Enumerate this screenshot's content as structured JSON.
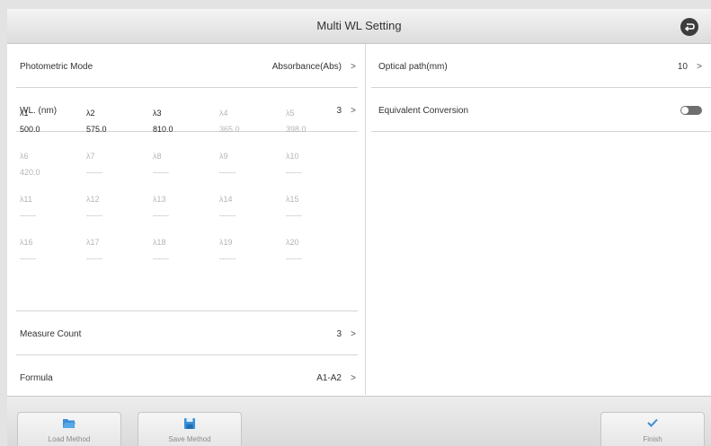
{
  "header": {
    "title": "Multi WL Setting",
    "back_icon": "back-return-icon"
  },
  "left": {
    "photometric_mode": {
      "label": "Photometric Mode",
      "value": "Absorbance(Abs)",
      "chevron": ">"
    },
    "wl": {
      "label": "WL. (nm)",
      "value": "3",
      "chevron": ">"
    },
    "wavelengths": [
      {
        "name": "λ1",
        "value": "500.0",
        "active": true
      },
      {
        "name": "λ2",
        "value": "575.0",
        "active": true
      },
      {
        "name": "λ3",
        "value": "810.0",
        "active": true
      },
      {
        "name": "λ4",
        "value": "365.0",
        "active": false
      },
      {
        "name": "λ5",
        "value": "398.0",
        "active": false
      },
      {
        "name": "λ6",
        "value": "420.0",
        "active": false
      },
      {
        "name": "λ7",
        "value": "------",
        "active": false
      },
      {
        "name": "λ8",
        "value": "------",
        "active": false
      },
      {
        "name": "λ9",
        "value": "------",
        "active": false
      },
      {
        "name": "λ10",
        "value": "------",
        "active": false
      },
      {
        "name": "λ11",
        "value": "------",
        "active": false
      },
      {
        "name": "λ12",
        "value": "------",
        "active": false
      },
      {
        "name": "λ13",
        "value": "------",
        "active": false
      },
      {
        "name": "λ14",
        "value": "------",
        "active": false
      },
      {
        "name": "λ15",
        "value": "------",
        "active": false
      },
      {
        "name": "λ16",
        "value": "------",
        "active": false
      },
      {
        "name": "λ17",
        "value": "------",
        "active": false
      },
      {
        "name": "λ18",
        "value": "------",
        "active": false
      },
      {
        "name": "λ19",
        "value": "------",
        "active": false
      },
      {
        "name": "λ20",
        "value": "------",
        "active": false
      }
    ],
    "measure_count": {
      "label": "Measure Count",
      "value": "3",
      "chevron": ">"
    },
    "formula": {
      "label": "Formula",
      "value": "A1-A2",
      "chevron": ">"
    }
  },
  "right": {
    "optical_path": {
      "label": "Optical path(mm)",
      "value": "10",
      "chevron": ">"
    },
    "equivalent_conversion": {
      "label": "Equivalent Conversion",
      "enabled": false
    }
  },
  "footer": {
    "load_method": {
      "label": "Load Method",
      "icon": "folder-open-icon"
    },
    "save_method": {
      "label": "Save Method",
      "icon": "save-disk-icon"
    },
    "finish": {
      "label": "Finish",
      "icon": "checkmark-icon"
    }
  },
  "colors": {
    "accent": "#3a8fd6",
    "inactive_text": "#b5b5b5"
  }
}
